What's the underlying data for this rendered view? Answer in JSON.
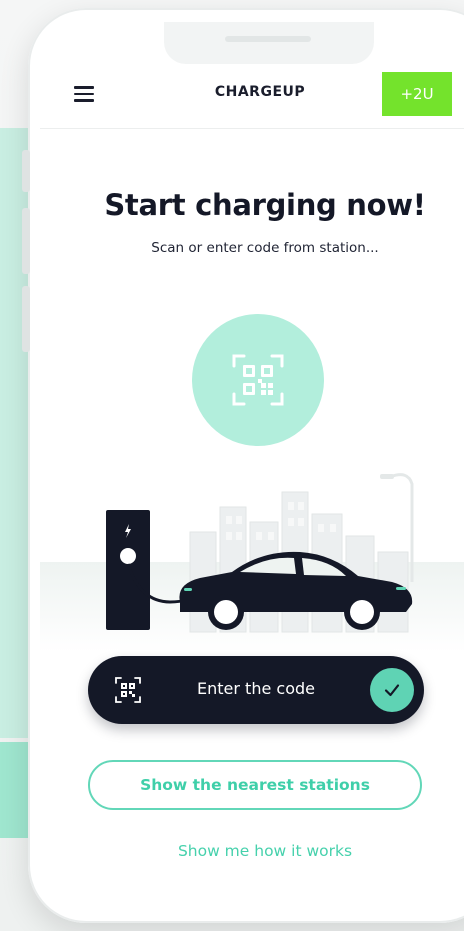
{
  "header": {
    "brand": "CHARGEUP",
    "plus_button": "+2U"
  },
  "hero": {
    "title": "Start charging now!",
    "subtitle": "Scan or enter code from station..."
  },
  "code_input": {
    "label": "Enter the code"
  },
  "actions": {
    "nearest_stations": "Show the nearest stations",
    "how_it_works": "Show me how it works"
  },
  "icons": {
    "menu": "hamburger-icon",
    "qr": "qr-scan-icon",
    "check": "check-icon",
    "bolt": "lightning-icon"
  },
  "colors": {
    "accent_mint": "#5fd3b4",
    "light_mint": "#b2eedc",
    "lime": "#74e32c",
    "navy": "#141827"
  }
}
